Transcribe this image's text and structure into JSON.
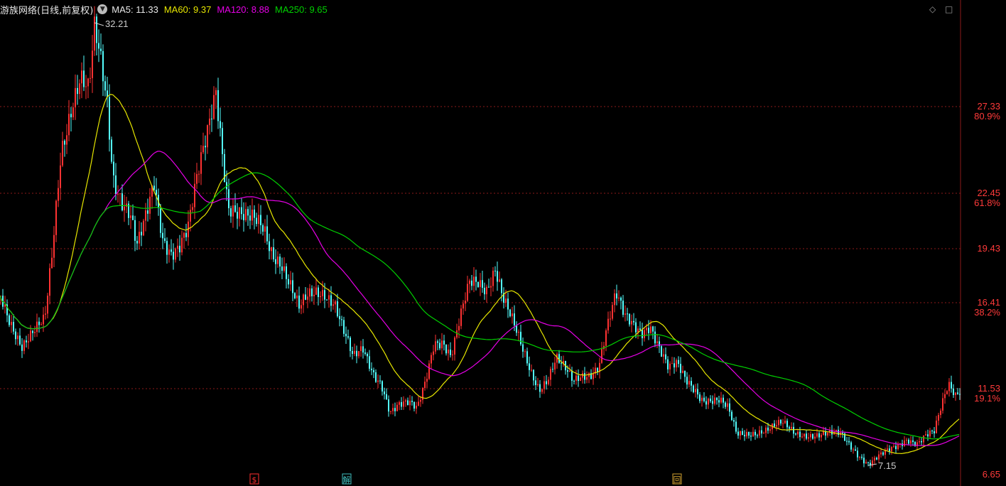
{
  "header": {
    "stock_label": "游族网络(日线,前复权)",
    "dropdown_icon": "chevron-down-icon",
    "ma": [
      {
        "label": "MA5: 11.33",
        "color": "#e8e8e8"
      },
      {
        "label": "MA60: 9.37",
        "color": "#e6e600"
      },
      {
        "label": "MA120: 8.88",
        "color": "#e600e6"
      },
      {
        "label": "MA250: 9.65",
        "color": "#00d000"
      }
    ],
    "corner_icons": [
      "diamond-icon",
      "window-icon"
    ]
  },
  "markers": [
    {
      "label": "$",
      "color": "#ff3030"
    },
    {
      "label": "解",
      "color": "#40c0c0"
    },
    {
      "label": "回",
      "color": "#d0a030"
    }
  ],
  "chart_data": {
    "type": "candlestick",
    "y_axis_labels": [
      {
        "value": 27.33,
        "text": "27.33",
        "pct": "80.9%"
      },
      {
        "value": 22.45,
        "text": "22.45",
        "pct": "61.8%"
      },
      {
        "value": 19.43,
        "text": "19.43",
        "pct": ""
      },
      {
        "value": 16.41,
        "text": "16.41",
        "pct": "38.2%"
      },
      {
        "value": 11.53,
        "text": "11.53",
        "pct": "19.1%"
      },
      {
        "value": 6.65,
        "text": "6.65",
        "pct": ""
      }
    ],
    "high_marker": {
      "value": 32.21,
      "label": "32.21"
    },
    "low_marker": {
      "value": 7.15,
      "label": "7.15"
    },
    "colors": {
      "up": "#ff3232",
      "down": "#54ffff",
      "ma5": "#e8e8e8",
      "ma60": "#e6e600",
      "ma120": "#e600e6",
      "ma250": "#00d000",
      "grid": "#8b1a1a",
      "axis_text": "#ff3a3a"
    },
    "price_anchors": [
      [
        0,
        16.8
      ],
      [
        12,
        15.6
      ],
      [
        30,
        14.0
      ],
      [
        50,
        14.8
      ],
      [
        62,
        15.3
      ],
      [
        72,
        19.0
      ],
      [
        85,
        25.0
      ],
      [
        100,
        27.6
      ],
      [
        112,
        29.0
      ],
      [
        124,
        28.0
      ],
      [
        132,
        31.5
      ],
      [
        140,
        30.0
      ],
      [
        150,
        27.5
      ],
      [
        158,
        23.5
      ],
      [
        170,
        22.3
      ],
      [
        182,
        21.5
      ],
      [
        192,
        19.5
      ],
      [
        205,
        21.0
      ],
      [
        216,
        22.8
      ],
      [
        228,
        20.0
      ],
      [
        240,
        19.4
      ],
      [
        252,
        19.8
      ],
      [
        264,
        20.6
      ],
      [
        276,
        23.0
      ],
      [
        290,
        25.5
      ],
      [
        303,
        28.4
      ],
      [
        312,
        25.0
      ],
      [
        320,
        22.0
      ],
      [
        332,
        21.5
      ],
      [
        344,
        21.0
      ],
      [
        358,
        20.8
      ],
      [
        370,
        20.5
      ],
      [
        382,
        19.3
      ],
      [
        395,
        18.8
      ],
      [
        408,
        17.4
      ],
      [
        420,
        16.0
      ],
      [
        432,
        16.6
      ],
      [
        444,
        16.9
      ],
      [
        456,
        17.0
      ],
      [
        470,
        16.6
      ],
      [
        482,
        15.0
      ],
      [
        496,
        13.2
      ],
      [
        510,
        13.6
      ],
      [
        524,
        12.4
      ],
      [
        536,
        11.9
      ],
      [
        548,
        10.3
      ],
      [
        560,
        10.6
      ],
      [
        575,
        10.6
      ],
      [
        586,
        10.3
      ],
      [
        598,
        12.0
      ],
      [
        610,
        14.3
      ],
      [
        622,
        14.3
      ],
      [
        634,
        13.3
      ],
      [
        648,
        15.6
      ],
      [
        660,
        17.4
      ],
      [
        672,
        17.6
      ],
      [
        684,
        17.3
      ],
      [
        696,
        18.5
      ],
      [
        708,
        16.6
      ],
      [
        720,
        15.3
      ],
      [
        734,
        13.7
      ],
      [
        746,
        12.5
      ],
      [
        758,
        11.6
      ],
      [
        770,
        12.2
      ],
      [
        782,
        13.3
      ],
      [
        794,
        12.6
      ],
      [
        806,
        11.8
      ],
      [
        818,
        12.2
      ],
      [
        830,
        12.4
      ],
      [
        842,
        13.0
      ],
      [
        852,
        14.9
      ],
      [
        866,
        16.8
      ],
      [
        878,
        15.5
      ],
      [
        890,
        15.1
      ],
      [
        902,
        14.8
      ],
      [
        914,
        15.3
      ],
      [
        926,
        14.0
      ],
      [
        940,
        12.6
      ],
      [
        952,
        12.8
      ],
      [
        964,
        12.0
      ],
      [
        976,
        11.6
      ],
      [
        988,
        11.0
      ],
      [
        1000,
        10.9
      ],
      [
        1012,
        10.8
      ],
      [
        1024,
        10.3
      ],
      [
        1036,
        8.9
      ],
      [
        1050,
        9.0
      ],
      [
        1064,
        9.1
      ],
      [
        1080,
        9.2
      ],
      [
        1100,
        9.5
      ],
      [
        1118,
        9.0
      ],
      [
        1134,
        8.95
      ],
      [
        1150,
        8.9
      ],
      [
        1166,
        8.9
      ],
      [
        1182,
        8.9
      ],
      [
        1196,
        8.3
      ],
      [
        1210,
        7.7
      ],
      [
        1222,
        7.25
      ],
      [
        1234,
        7.6
      ],
      [
        1248,
        7.9
      ],
      [
        1262,
        8.2
      ],
      [
        1276,
        8.7
      ],
      [
        1290,
        8.5
      ],
      [
        1302,
        8.9
      ],
      [
        1314,
        9.0
      ],
      [
        1324,
        10.4
      ],
      [
        1334,
        11.7
      ],
      [
        1344,
        11.2
      ],
      [
        1350,
        11.5
      ]
    ]
  }
}
